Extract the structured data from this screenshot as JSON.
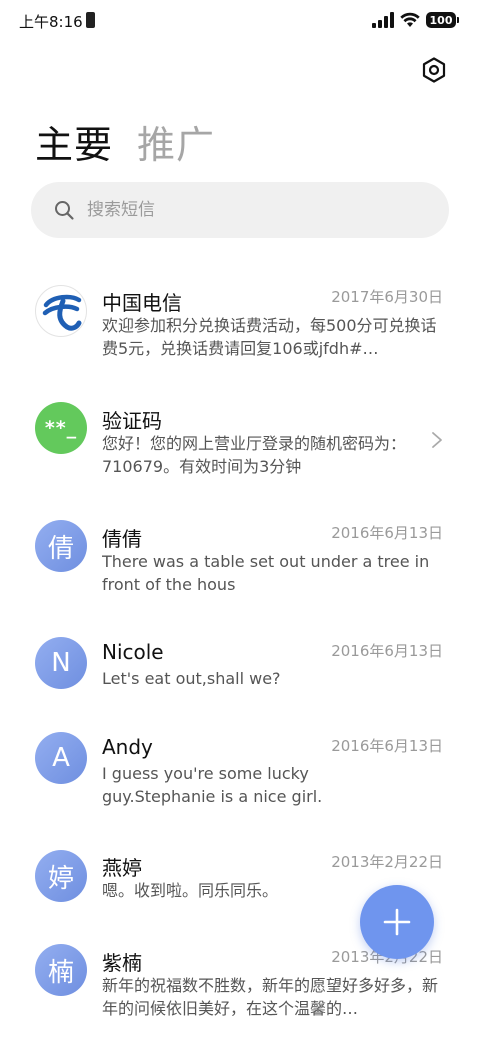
{
  "status_bar": {
    "time": "上午8:16",
    "battery": "100"
  },
  "header": {
    "settings_icon": "settings-hexagon-icon",
    "tabs": [
      {
        "label": "主要",
        "active": true
      },
      {
        "label": "推广",
        "active": false
      }
    ]
  },
  "search": {
    "placeholder": "搜索短信",
    "value": ""
  },
  "conversations": [
    {
      "sender": "中国电信",
      "date": "2017年6月30日",
      "snippet": "欢迎参加积分兑换话费活动，每500分可兑换话费5元，兑换话费请回复106或jfdh#…",
      "avatar": "china-telecom-logo"
    },
    {
      "sender": "验证码",
      "date": "",
      "snippet": "您好！您的网上营业厅登录的随机密码为：710679。有效时间为3分钟",
      "avatar_text": "**_"
    },
    {
      "sender": "倩倩",
      "date": "2016年6月13日",
      "snippet": "There was a table set out under a tree in front of the hous",
      "avatar_text": "倩"
    },
    {
      "sender": "Nicole",
      "date": "2016年6月13日",
      "snippet": "Let's eat out,shall we?",
      "avatar_text": "N"
    },
    {
      "sender": "Andy",
      "date": "2016年6月13日",
      "snippet": "I guess you're some lucky guy.Stephanie is a nice girl.",
      "avatar_text": "A"
    },
    {
      "sender": "燕婷",
      "date": "2013年2月22日",
      "snippet": "嗯。收到啦。同乐同乐。",
      "avatar_text": "婷"
    },
    {
      "sender": "紫楠",
      "date": "2013年2月22日",
      "snippet": "新年的祝福数不胜数，新年的愿望好多好多，新年的问候依旧美好，在这个温馨的…",
      "avatar_text": "楠"
    }
  ],
  "fab": {
    "icon": "plus-icon"
  },
  "colors": {
    "accent": "#6f95ee",
    "verification_avatar": "#63c95c",
    "telecom_blue": "#1f5fb4"
  }
}
